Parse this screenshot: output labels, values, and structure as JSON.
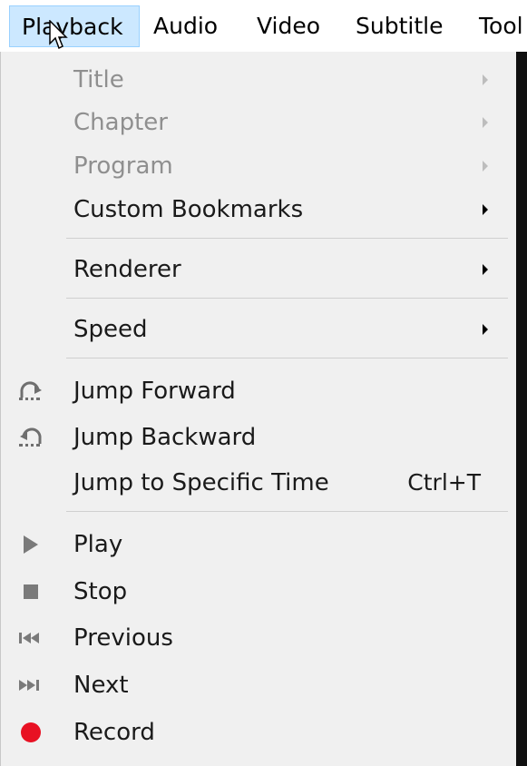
{
  "menubar": {
    "items": [
      {
        "label": "Playback"
      },
      {
        "label": "Audio"
      },
      {
        "label": "Video"
      },
      {
        "label": "Subtitle"
      },
      {
        "label": "Tool"
      }
    ]
  },
  "menu": {
    "items": [
      {
        "label": "Title",
        "submenu": true,
        "enabled": false
      },
      {
        "label": "Chapter",
        "submenu": true,
        "enabled": false
      },
      {
        "label": "Program",
        "submenu": true,
        "enabled": false
      },
      {
        "label": "Custom Bookmarks",
        "submenu": true,
        "enabled": true
      },
      {
        "label": "Renderer",
        "submenu": true,
        "enabled": true
      },
      {
        "label": "Speed",
        "submenu": true,
        "enabled": true
      },
      {
        "label": "Jump Forward",
        "icon": "jump-forward-icon",
        "enabled": true
      },
      {
        "label": "Jump Backward",
        "icon": "jump-backward-icon",
        "enabled": true
      },
      {
        "label": "Jump to Specific Time",
        "shortcut": "Ctrl+T",
        "enabled": true
      },
      {
        "label": "Play",
        "icon": "play-icon",
        "enabled": true
      },
      {
        "label": "Stop",
        "icon": "stop-icon",
        "enabled": true
      },
      {
        "label": "Previous",
        "icon": "previous-icon",
        "enabled": true
      },
      {
        "label": "Next",
        "icon": "next-icon",
        "enabled": true
      },
      {
        "label": "Record",
        "icon": "record-icon",
        "enabled": true
      }
    ]
  },
  "colors": {
    "menu_background": "#f0f0f0",
    "active_menubar_item": "#cce8ff",
    "disabled_text": "#8f8f8f",
    "record_red": "#e81123",
    "icon_gray": "#7a7a7a"
  }
}
